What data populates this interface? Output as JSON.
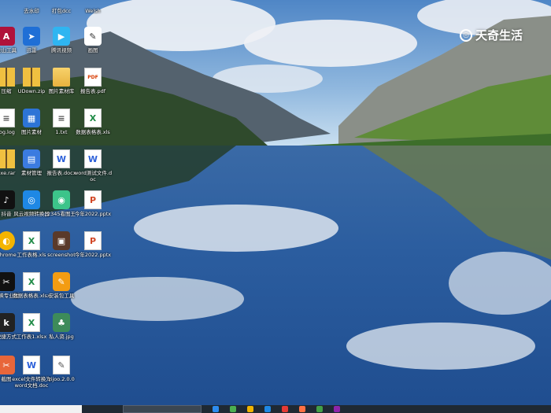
{
  "watermark": {
    "text": "天奇生活"
  },
  "top_row": [
    {
      "label": "去水印"
    },
    {
      "label": "打包dcc"
    },
    {
      "label": "Welsh"
    }
  ],
  "rows": [
    [
      {
        "label": "金山工具",
        "kind": "app",
        "color": "#b0123a",
        "glyph": "A"
      },
      {
        "label": "迅雷",
        "kind": "app",
        "color": "#1f6fd6",
        "glyph": "➤"
      },
      {
        "label": "腾讯视频",
        "kind": "app",
        "color": "#2fb5f1",
        "glyph": "▶"
      },
      {
        "label": "画图",
        "kind": "app",
        "color": "#ffffff",
        "glyph": "✎"
      }
    ],
    [
      {
        "label": "压缩",
        "kind": "zip"
      },
      {
        "label": "UDown.zip",
        "kind": "zip"
      },
      {
        "label": "图片素材库",
        "kind": "folder"
      },
      {
        "label": "报告表.pdf",
        "kind": "pdf",
        "glyph": "PDF"
      }
    ],
    [
      {
        "label": "log.log",
        "kind": "doc",
        "glyph": "≡"
      },
      {
        "label": "图片素材",
        "kind": "app",
        "color": "#2d74d6",
        "glyph": "▦"
      },
      {
        "label": "1.txt",
        "kind": "doc",
        "glyph": "≡"
      },
      {
        "label": "数据表格表.xls",
        "kind": "excel",
        "glyph": "X"
      }
    ],
    [
      {
        "label": "exe.rar",
        "kind": "zip"
      },
      {
        "label": "素材管理",
        "kind": "app",
        "color": "#3b7be0",
        "glyph": "▤"
      },
      {
        "label": "报告表.docx",
        "kind": "word",
        "glyph": "W"
      },
      {
        "label": "word测试文件.doc",
        "kind": "word",
        "glyph": "W"
      }
    ],
    [
      {
        "label": "抖音",
        "kind": "app",
        "color": "#111111",
        "glyph": "♪"
      },
      {
        "label": "风云视频转换器",
        "kind": "app",
        "color": "#1e88e5",
        "glyph": "◎"
      },
      {
        "label": "2345看图王",
        "kind": "app",
        "color": "#3cc48a",
        "glyph": "◉"
      },
      {
        "label": "今年2022.pptx",
        "kind": "ppt",
        "glyph": "P"
      }
    ],
    [
      {
        "label": "Chrome",
        "kind": "app",
        "color": "#f4b400",
        "glyph": "◐",
        "round": true
      },
      {
        "label": "工作表格.xls",
        "kind": "excel",
        "glyph": "X"
      },
      {
        "label": "screenshot",
        "kind": "app",
        "color": "#5a3a2a",
        "glyph": "▣"
      },
      {
        "label": "今年2022.pptx",
        "kind": "ppt",
        "glyph": "P"
      }
    ],
    [
      {
        "label": "剪映专业版",
        "kind": "app",
        "color": "#111111",
        "glyph": "✂"
      },
      {
        "label": "数据表格表.xlsx",
        "kind": "excel",
        "glyph": "X"
      },
      {
        "label": "安装包工具",
        "kind": "app",
        "color": "#f39c12",
        "glyph": "✎"
      }
    ],
    [
      {
        "label": "快捷方式",
        "kind": "app",
        "color": "#222222",
        "glyph": "k"
      },
      {
        "label": "工作表1.xlsx",
        "kind": "excel",
        "glyph": "X"
      },
      {
        "label": "私人资.jpg",
        "kind": "app",
        "color": "#3d8b5a",
        "glyph": "♣"
      }
    ],
    [
      {
        "label": "截图",
        "kind": "app",
        "color": "#e8663a",
        "glyph": "✂"
      },
      {
        "label": "excel文件转换为word文档.doc",
        "kind": "word",
        "glyph": "W"
      },
      {
        "label": "zijoo.2.0.0",
        "kind": "doc",
        "glyph": "✎"
      }
    ]
  ],
  "taskbar": {
    "icons": [
      "#2d8cf0",
      "#4caf50",
      "#f0b400",
      "#1e88e5",
      "#e53935",
      "#ff7043",
      "#43a047",
      "#8e24aa"
    ]
  }
}
